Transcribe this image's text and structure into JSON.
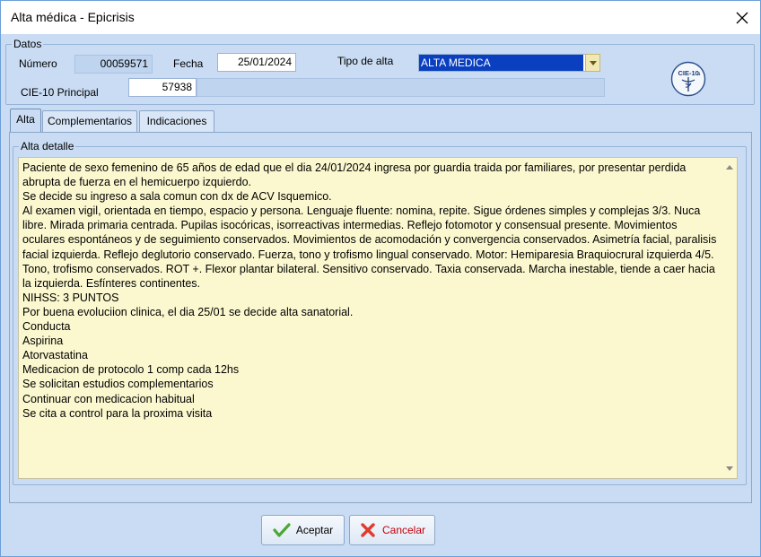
{
  "window": {
    "title": "Alta médica - Epicrisis"
  },
  "datos": {
    "legend": "Datos",
    "numero_label": "Número",
    "numero_value": "00059571",
    "fecha_label": "Fecha",
    "fecha_value": "25/01/2024",
    "tipo_alta_label": "Tipo de alta",
    "tipo_alta_value": "ALTA MEDICA",
    "cie_label": "CIE-10 Principal",
    "cie_code": "57938",
    "cie_description": "",
    "cie_icon_text": "CIE-10",
    "cie_icon_suffix": "a"
  },
  "tabs": [
    {
      "label": "Alta",
      "active": true
    },
    {
      "label": "Complementarios",
      "active": false
    },
    {
      "label": "Indicaciones",
      "active": false
    }
  ],
  "alta_detalle": {
    "legend": "Alta detalle",
    "text": "Paciente de sexo femenino de 65 años de edad que el dia 24/01/2024 ingresa por guardia traida por familiares, por presentar perdida abrupta de fuerza en el hemicuerpo izquierdo.\nSe decide su ingreso a sala comun con dx de ACV Isquemico.\nAl examen vigil, orientada en tiempo, espacio y persona. Lenguaje fluente: nomina, repite. Sigue órdenes simples y complejas 3/3. Nuca libre. Mirada primaria centrada. Pupilas isocóricas, isorreactivas intermedias. Reflejo fotomotor y consensual presente. Movimientos oculares espontáneos y de seguimiento conservados. Movimientos de acomodación y convergencia conservados. Asimetría facial, paralisis facial izquierda. Reflejo deglutorio conservado. Fuerza, tono y trofismo lingual conservado. Motor: Hemiparesia Braquiocrural izquierda 4/5. Tono, trofismo conservados. ROT +. Flexor plantar bilateral. Sensitivo conservado. Taxia conservada. Marcha inestable, tiende a caer hacia la izquierda. Esfínteres continentes.\nNIHSS: 3 PUNTOS\nPor buena evoluciion clinica, el dia 25/01 se decide alta sanatorial.\nConducta\nAspirina\nAtorvastatina\nMedicacion de protocolo 1 comp cada 12hs\nSe solicitan estudios complementarios\nContinuar con medicacion habitual\nSe cita a control para la proxima visita"
  },
  "buttons": {
    "accept_label": "Aceptar",
    "cancel_label": "Cancelar"
  },
  "colors": {
    "window_bg": "#c9dcf3",
    "memo_bg": "#fbf8cf",
    "selection": "#0a3fbf",
    "cancel_text": "#c2000b",
    "accept_icon": "#4aa834",
    "cancel_icon": "#e23a2c"
  },
  "icons": {
    "close": "close-icon",
    "combo_dropdown": "chevron-down-icon",
    "cie": "caduceus-icon",
    "accept": "checkmark-icon",
    "cancel": "cross-icon"
  }
}
